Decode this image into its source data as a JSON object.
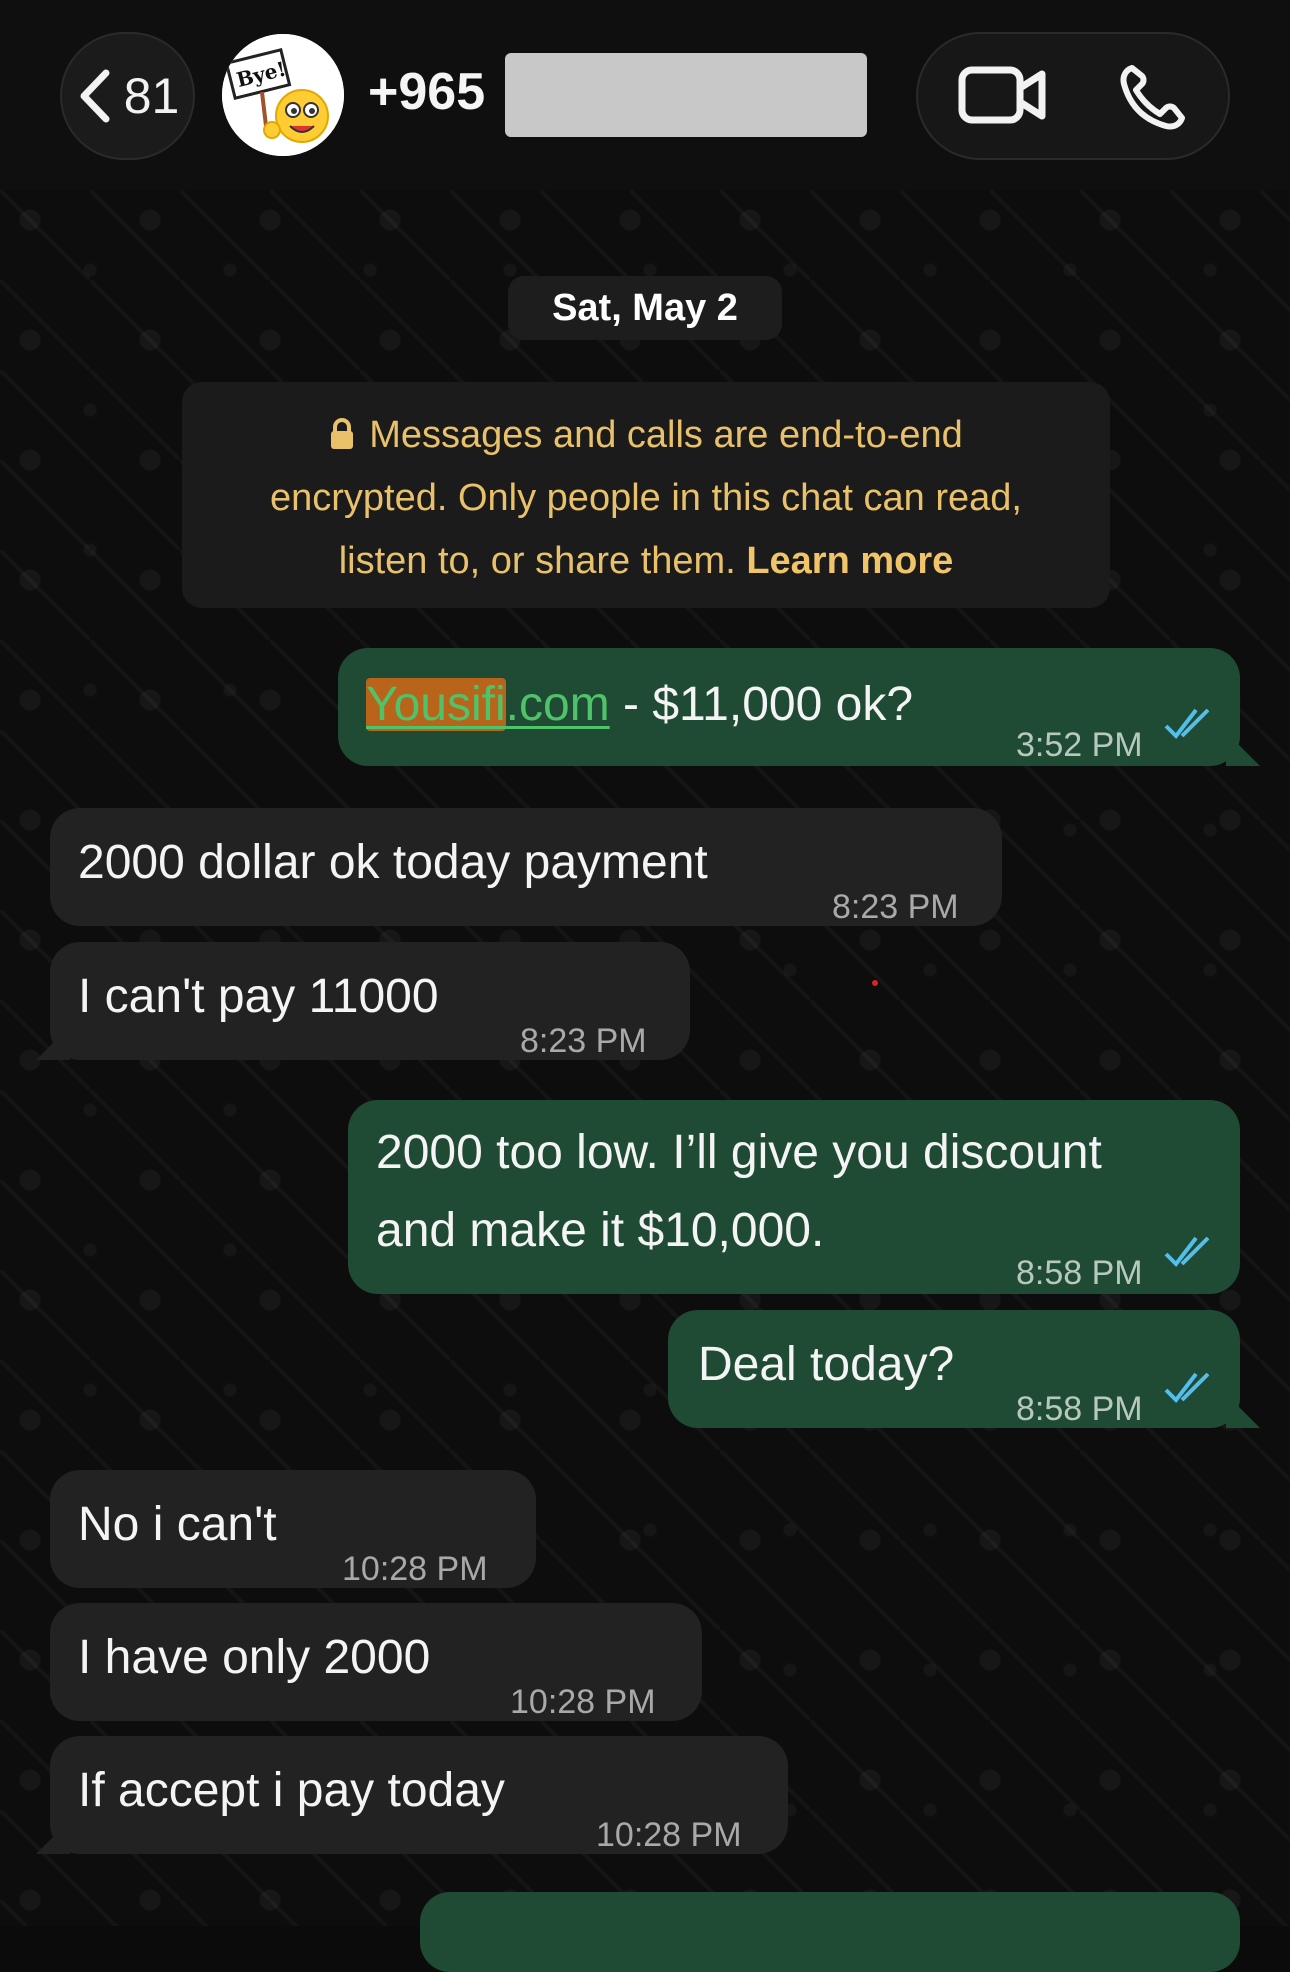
{
  "header": {
    "back_count": "81",
    "contact_name": "+965",
    "avatar_text": "Bye!"
  },
  "date_chip": "Sat, May 2",
  "encryption_notice": {
    "line1": "Messages and calls are end-to-end",
    "line2": "encrypted. Only people in this chat can read,",
    "line3": "listen to, or share them.",
    "learn_more": "Learn more"
  },
  "messages": [
    {
      "direction": "outgoing",
      "link_part1": "Yousifi",
      "link_part2": ".com",
      "text": " - $11,000 ok?",
      "time": "3:52 PM",
      "status": "read"
    },
    {
      "direction": "incoming",
      "text": "2000 dollar ok today payment",
      "time": "8:23 PM"
    },
    {
      "direction": "incoming",
      "text": "I can't pay 11000",
      "time": "8:23 PM"
    },
    {
      "direction": "outgoing",
      "text_line1": "2000 too low. I’ll give you discount",
      "text_line2": "and make it $10,000.",
      "time": "8:58 PM",
      "status": "read"
    },
    {
      "direction": "outgoing",
      "text": "Deal today?",
      "time": "8:58 PM",
      "status": "read"
    },
    {
      "direction": "incoming",
      "text": "No i can't",
      "time": "10:28 PM"
    },
    {
      "direction": "incoming",
      "text": "I have only 2000",
      "time": "10:28 PM"
    },
    {
      "direction": "incoming",
      "text": "If accept i pay today",
      "time": "10:28 PM"
    }
  ],
  "colors": {
    "outgoing_bubble": "#1f4a33",
    "incoming_bubble": "#222222",
    "read_ticks": "#53bdeb",
    "notice_text": "#e8c16a"
  },
  "icons": [
    "back-chevron-icon",
    "video-call-icon",
    "phone-call-icon",
    "lock-icon",
    "double-check-icon"
  ]
}
